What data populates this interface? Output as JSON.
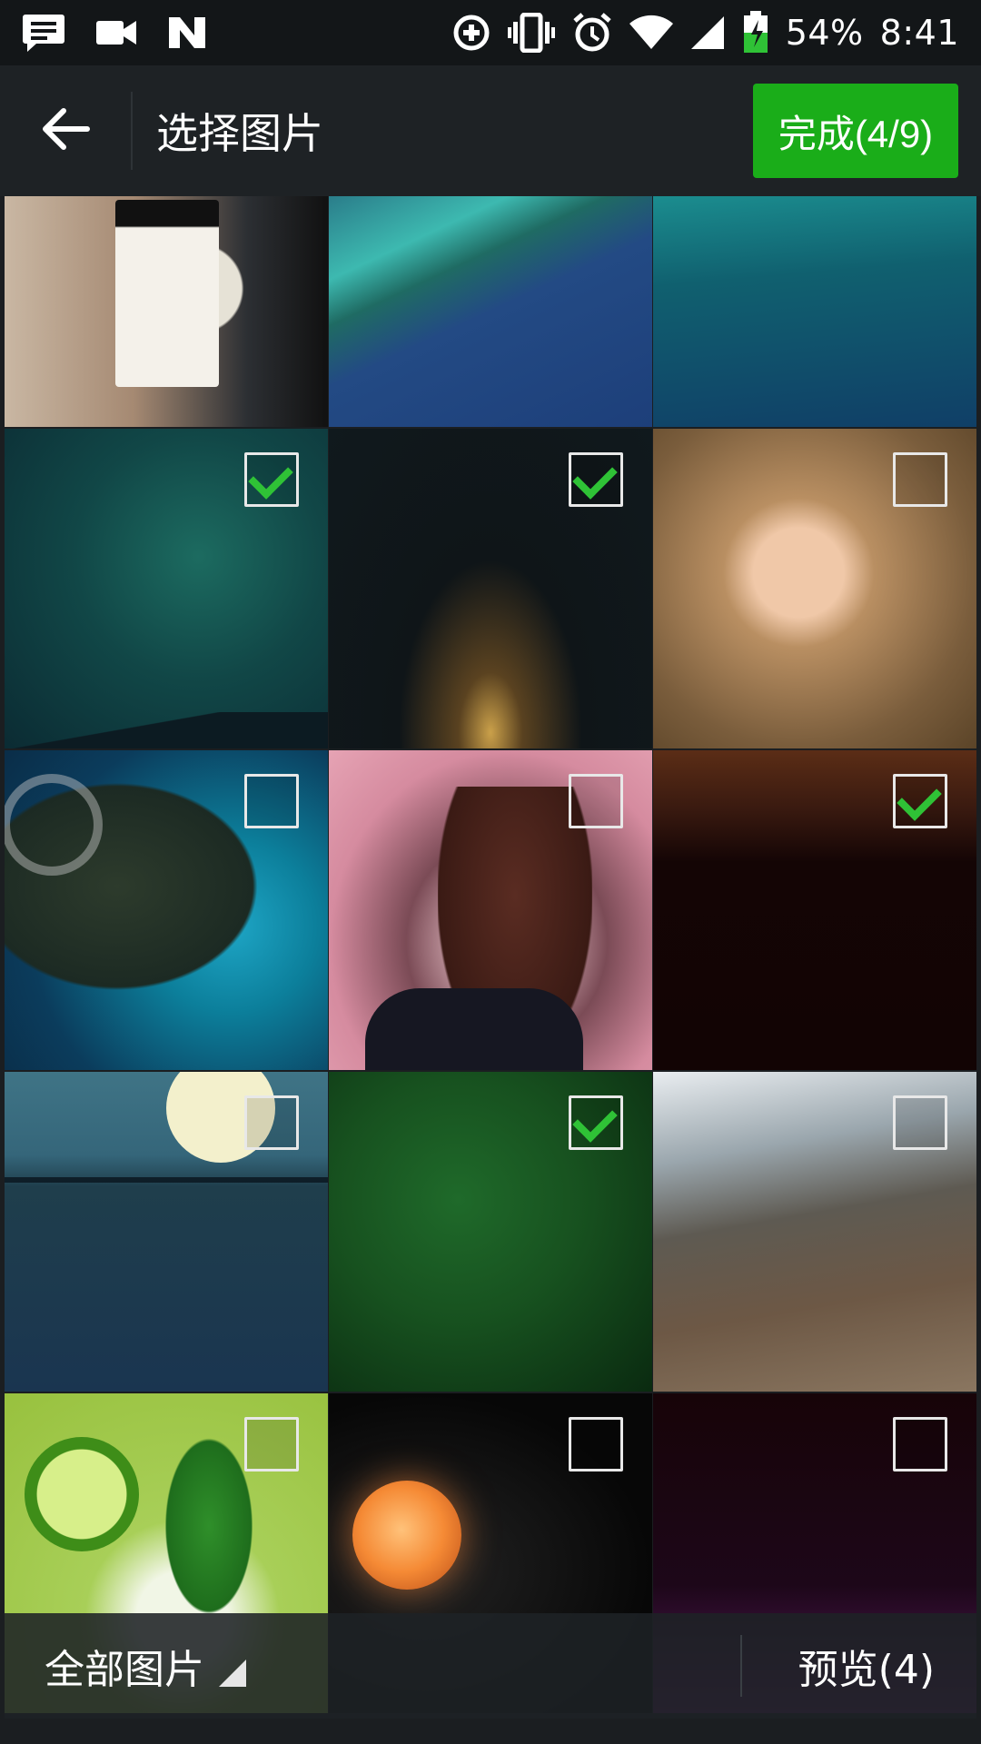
{
  "status_bar": {
    "battery_percent": "54%",
    "time": "8:41",
    "left_icons": [
      "message-icon",
      "video-camera-icon",
      "n-logo-icon"
    ],
    "right_icons": [
      "data-saver-icon",
      "vibrate-icon",
      "alarm-icon",
      "wifi-icon",
      "cell-signal-icon",
      "battery-charging-icon"
    ]
  },
  "toolbar": {
    "title": "选择图片",
    "done_label": "完成(4/9)",
    "done_color": "#1aad19"
  },
  "grid": {
    "items": [
      {
        "id": 1,
        "selectable": false,
        "checked": false
      },
      {
        "id": 2,
        "selectable": false,
        "checked": false
      },
      {
        "id": 3,
        "selectable": false,
        "checked": false
      },
      {
        "id": 4,
        "selectable": true,
        "checked": true
      },
      {
        "id": 5,
        "selectable": true,
        "checked": true
      },
      {
        "id": 6,
        "selectable": true,
        "checked": false
      },
      {
        "id": 7,
        "selectable": true,
        "checked": false
      },
      {
        "id": 8,
        "selectable": true,
        "checked": false
      },
      {
        "id": 9,
        "selectable": true,
        "checked": true
      },
      {
        "id": 10,
        "selectable": true,
        "checked": false
      },
      {
        "id": 11,
        "selectable": true,
        "checked": true
      },
      {
        "id": 12,
        "selectable": true,
        "checked": false
      },
      {
        "id": 13,
        "selectable": true,
        "checked": false
      },
      {
        "id": 14,
        "selectable": true,
        "checked": false
      },
      {
        "id": 15,
        "selectable": true,
        "checked": false
      }
    ],
    "check_color": "#2fc236"
  },
  "bottom_bar": {
    "album_label": "全部图片",
    "preview_label": "预览(4)"
  }
}
